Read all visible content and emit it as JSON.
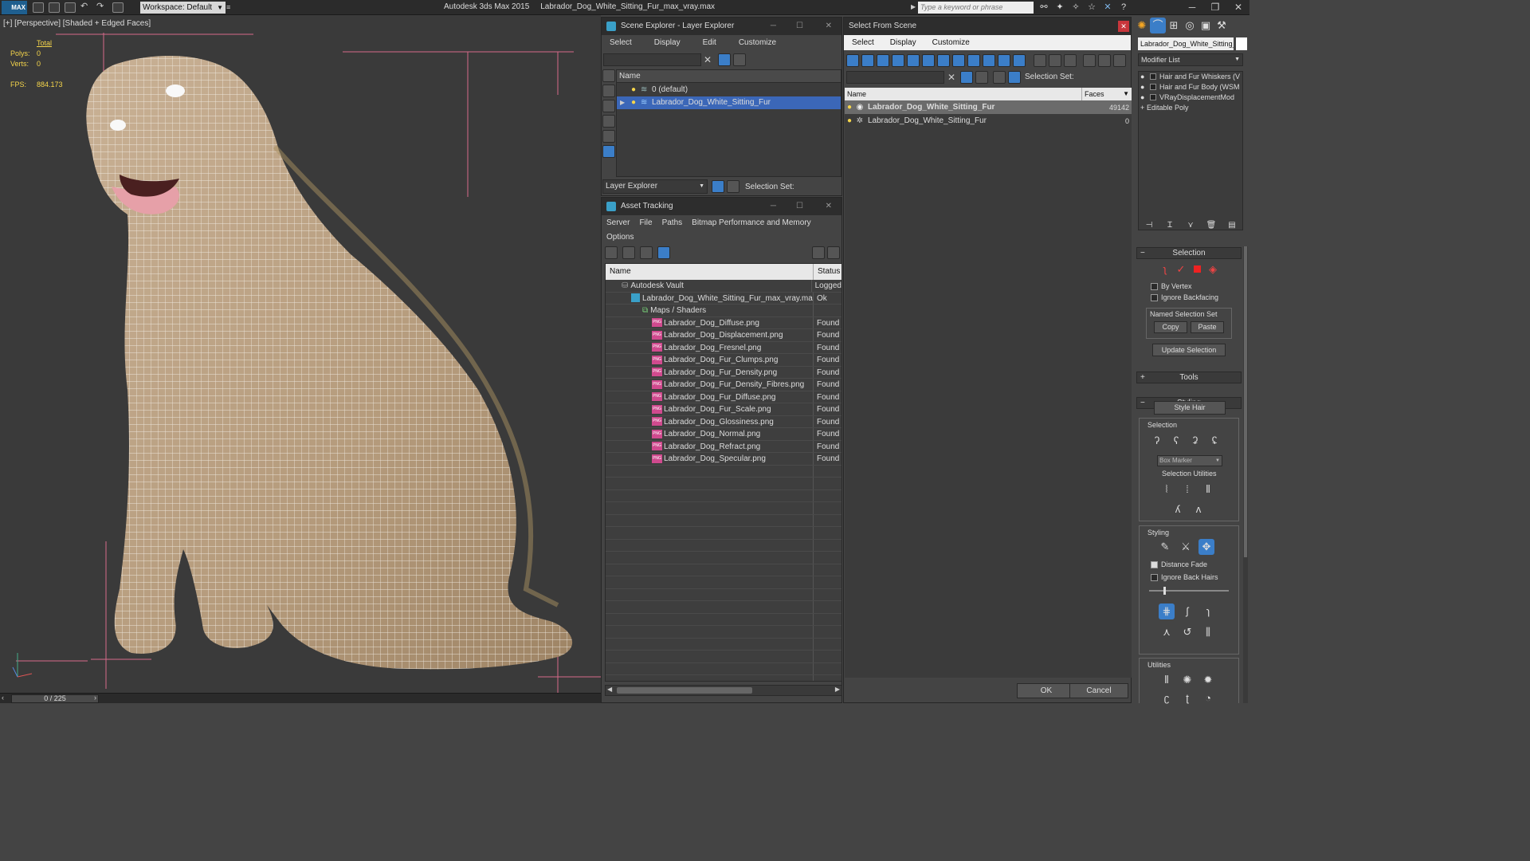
{
  "titlebar": {
    "logo": "MAX",
    "workspace": "Workspace: Default",
    "app_title": "Autodesk 3ds Max  2015",
    "file_title": "Labrador_Dog_White_Sitting_Fur_max_vray.max",
    "search_placeholder": "Type a keyword or phrase"
  },
  "viewport": {
    "label": "[+] [Perspective] [Shaded + Edged Faces]",
    "stats_header": "Total",
    "polys_label": "Polys:",
    "polys_value": "0",
    "verts_label": "Verts:",
    "verts_value": "0",
    "fps_label": "FPS:",
    "fps_value": "884.173"
  },
  "timeline": {
    "frame": "0 / 225"
  },
  "scene_explorer": {
    "title": "Scene Explorer - Layer Explorer",
    "menu": [
      "Select",
      "Display",
      "Edit",
      "Customize"
    ],
    "column_name": "Name",
    "rows": [
      "0 (default)",
      "Labrador_Dog_White_Sitting_Fur"
    ],
    "footer_mode": "Layer Explorer",
    "selection_set_label": "Selection Set:"
  },
  "asset_tracking": {
    "title": "Asset Tracking",
    "menu": [
      "Server",
      "File",
      "Paths",
      "Bitmap Performance and Memory"
    ],
    "menu2": [
      "Options"
    ],
    "col_name": "Name",
    "col_status": "Status",
    "vault": {
      "name": "Autodesk Vault",
      "status": "Logged"
    },
    "file": {
      "name": "Labrador_Dog_White_Sitting_Fur_max_vray.max",
      "status": "Ok"
    },
    "maps_group": "Maps / Shaders",
    "maps": [
      {
        "name": "Labrador_Dog_Diffuse.png",
        "status": "Found"
      },
      {
        "name": "Labrador_Dog_Displacement.png",
        "status": "Found"
      },
      {
        "name": "Labrador_Dog_Fresnel.png",
        "status": "Found"
      },
      {
        "name": "Labrador_Dog_Fur_Clumps.png",
        "status": "Found"
      },
      {
        "name": "Labrador_Dog_Fur_Density.png",
        "status": "Found"
      },
      {
        "name": "Labrador_Dog_Fur_Density_Fibres.png",
        "status": "Found"
      },
      {
        "name": "Labrador_Dog_Fur_Diffuse.png",
        "status": "Found"
      },
      {
        "name": "Labrador_Dog_Fur_Scale.png",
        "status": "Found"
      },
      {
        "name": "Labrador_Dog_Glossiness.png",
        "status": "Found"
      },
      {
        "name": "Labrador_Dog_Normal.png",
        "status": "Found"
      },
      {
        "name": "Labrador_Dog_Refract.png",
        "status": "Found"
      },
      {
        "name": "Labrador_Dog_Specular.png",
        "status": "Found"
      }
    ],
    "png_badge": "PNG"
  },
  "select_from_scene": {
    "title": "Select From Scene",
    "menu": [
      "Select",
      "Display",
      "Customize"
    ],
    "selection_set_label": "Selection Set:",
    "col_name": "Name",
    "col_faces": "Faces",
    "rows": [
      {
        "name": "Labrador_Dog_White_Sitting_Fur",
        "faces": "49142"
      },
      {
        "name": "Labrador_Dog_White_Sitting_Fur",
        "faces": "0"
      }
    ],
    "ok": "OK",
    "cancel": "Cancel"
  },
  "command_panel": {
    "object_name": "Labrador_Dog_White_Sitting_",
    "modifier_list": "Modifier List",
    "stack": [
      "Hair and Fur Whiskers (V",
      "Hair and Fur Body (WSM",
      "VRayDisplacementMod",
      "Editable Poly"
    ],
    "selection_rollout": "Selection",
    "by_vertex": "By Vertex",
    "ignore_backfacing": "Ignore Backfacing",
    "named_selection_set": "Named Selection Set",
    "copy": "Copy",
    "paste": "Paste",
    "update_selection": "Update Selection",
    "tools_rollout": "Tools",
    "styling_rollout": "Styling",
    "style_hair": "Style Hair",
    "selection_group": "Selection",
    "box_marker": "Box Marker",
    "selection_utilities": "Selection Utilities",
    "styling_group": "Styling",
    "distance_fade": "Distance Fade",
    "ignore_back_hairs": "Ignore Back Hairs",
    "utilities_group": "Utilities"
  },
  "colors": {
    "selection_blue": "#3b67b8",
    "stat_yellow": "#f5d54b",
    "png_badge": "#d04a8e"
  }
}
